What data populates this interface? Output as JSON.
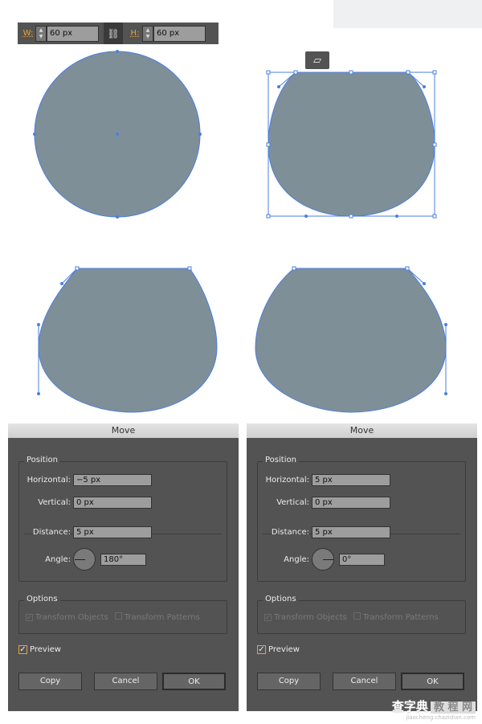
{
  "toolbar": {
    "w_label": "W:",
    "w_value": "60 px",
    "h_label": "H:",
    "h_value": "60 px",
    "link_icon": "link-icon"
  },
  "eraser_icon": "eraser-icon",
  "colors": {
    "shape_fill": "#7f8f98",
    "path_stroke": "#4a7fe0",
    "dialog_bg": "#535353",
    "accent": "#e8a23a"
  },
  "dialogs": [
    {
      "title": "Move",
      "position_label": "Position",
      "horizontal_label": "Horizontal:",
      "horizontal": "−5 px",
      "vertical_label": "Vertical:",
      "vertical": "0 px",
      "distance_label": "Distance:",
      "distance": "5 px",
      "angle_label": "Angle:",
      "angle": "180°",
      "options_label": "Options",
      "transform_objects": "Transform Objects",
      "transform_patterns": "Transform Patterns",
      "preview": "Preview",
      "copy": "Copy",
      "cancel": "Cancel",
      "ok": "OK"
    },
    {
      "title": "Move",
      "position_label": "Position",
      "horizontal_label": "Horizontal:",
      "horizontal": "5 px",
      "vertical_label": "Vertical:",
      "vertical": "0 px",
      "distance_label": "Distance:",
      "distance": "5 px",
      "angle_label": "Angle:",
      "angle": "0°",
      "options_label": "Options",
      "transform_objects": "Transform Objects",
      "transform_patterns": "Transform Patterns",
      "preview": "Preview",
      "copy": "Copy",
      "cancel": "Cancel",
      "ok": "OK"
    }
  ],
  "watermark": {
    "main": "查字典",
    "sub": "教 程 网",
    "url": "jiaocheng.chazidian.com"
  }
}
